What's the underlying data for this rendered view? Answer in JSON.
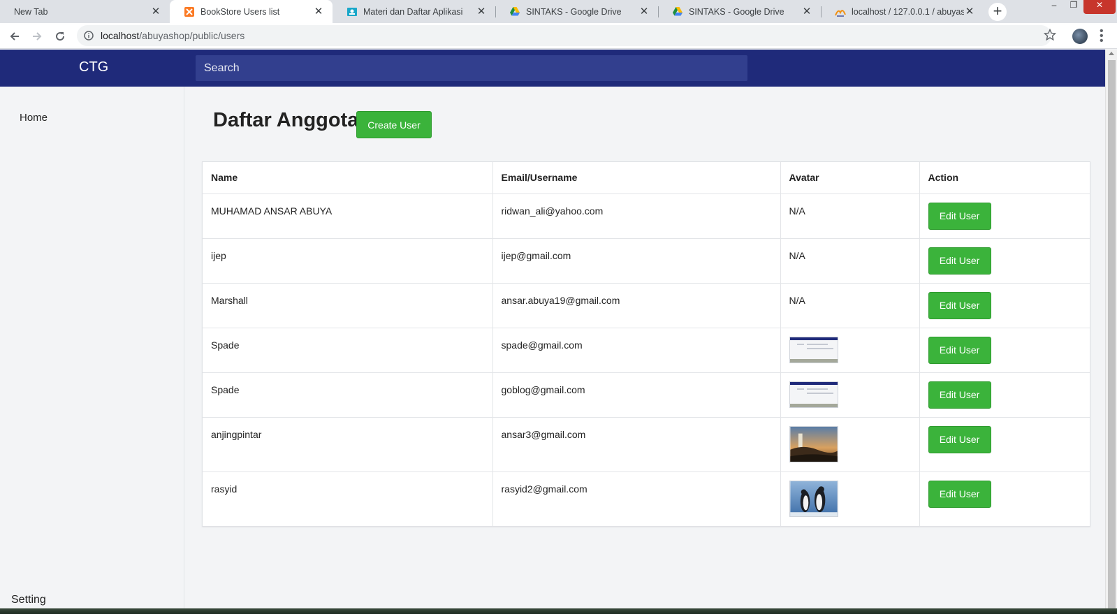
{
  "browser": {
    "tabs": [
      {
        "title": "New Tab",
        "favicon": "none",
        "active": false
      },
      {
        "title": "BookStore Users list",
        "favicon": "xampp-icon",
        "active": true
      },
      {
        "title": "Materi dan Daftar Aplikasi",
        "favicon": "classroom-icon",
        "active": false
      },
      {
        "title": "SINTAKS - Google Drive",
        "favicon": "google-drive-icon",
        "active": false
      },
      {
        "title": "SINTAKS - Google Drive",
        "favicon": "google-drive-icon",
        "active": false
      },
      {
        "title": "localhost / 127.0.0.1 / abuyashop",
        "favicon": "phpmyadmin-icon",
        "active": false
      }
    ],
    "new_tab_label": "+",
    "close_glyph": "✕",
    "url_host": "localhost",
    "url_path": "/abuyashop/public/users"
  },
  "header": {
    "brand": "CTG",
    "search_placeholder": "Search",
    "color": "#1f2a7a"
  },
  "sidebar": {
    "home": "Home",
    "setting": "Setting"
  },
  "main": {
    "title": "Daftar Anggota",
    "create_button": "Create User",
    "columns": [
      "Name",
      "Email/Username",
      "Avatar",
      "Action"
    ],
    "edit_label": "Edit User",
    "rows": [
      {
        "name": "MUHAMAD ANSAR ABUYA",
        "email": "ridwan_ali@yahoo.com",
        "avatar": "N/A",
        "avatar_kind": "none"
      },
      {
        "name": "ijep",
        "email": "ijep@gmail.com",
        "avatar": "N/A",
        "avatar_kind": "none"
      },
      {
        "name": "Marshall",
        "email": "ansar.abuya19@gmail.com",
        "avatar": "N/A",
        "avatar_kind": "none"
      },
      {
        "name": "Spade",
        "email": "spade@gmail.com",
        "avatar": "",
        "avatar_kind": "screenshot"
      },
      {
        "name": "Spade",
        "email": "goblog@gmail.com",
        "avatar": "",
        "avatar_kind": "screenshot"
      },
      {
        "name": "anjingpintar",
        "email": "ansar3@gmail.com",
        "avatar": "",
        "avatar_kind": "lighthouse-photo"
      },
      {
        "name": "rasyid",
        "email": "rasyid2@gmail.com",
        "avatar": "",
        "avatar_kind": "penguins-photo"
      }
    ]
  },
  "colors": {
    "accent_green": "#3bb33b",
    "header_blue": "#1f2a7a"
  }
}
